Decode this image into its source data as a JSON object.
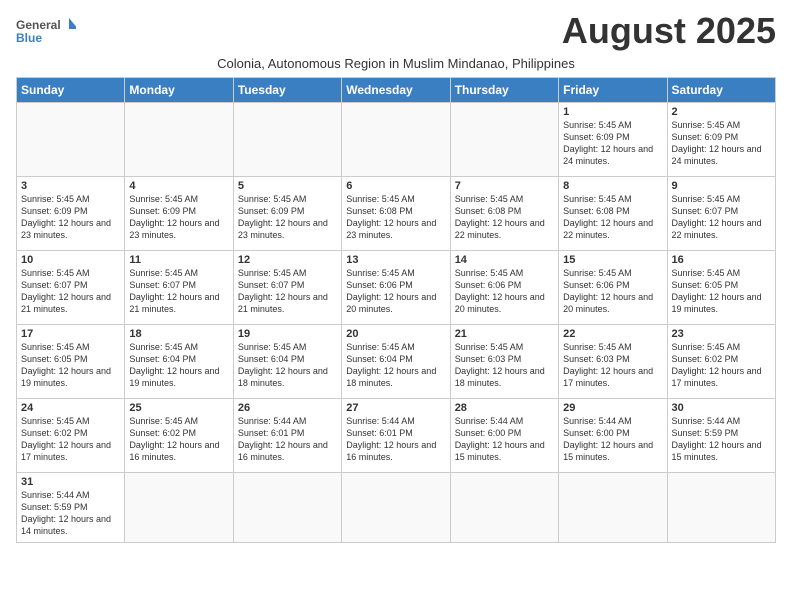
{
  "logo": {
    "text_general": "General",
    "text_blue": "Blue"
  },
  "title": "August 2025",
  "subtitle": "Colonia, Autonomous Region in Muslim Mindanao, Philippines",
  "days_of_week": [
    "Sunday",
    "Monday",
    "Tuesday",
    "Wednesday",
    "Thursday",
    "Friday",
    "Saturday"
  ],
  "weeks": [
    [
      {
        "day": "",
        "info": ""
      },
      {
        "day": "",
        "info": ""
      },
      {
        "day": "",
        "info": ""
      },
      {
        "day": "",
        "info": ""
      },
      {
        "day": "",
        "info": ""
      },
      {
        "day": "1",
        "info": "Sunrise: 5:45 AM\nSunset: 6:09 PM\nDaylight: 12 hours and 24 minutes."
      },
      {
        "day": "2",
        "info": "Sunrise: 5:45 AM\nSunset: 6:09 PM\nDaylight: 12 hours and 24 minutes."
      }
    ],
    [
      {
        "day": "3",
        "info": "Sunrise: 5:45 AM\nSunset: 6:09 PM\nDaylight: 12 hours and 23 minutes."
      },
      {
        "day": "4",
        "info": "Sunrise: 5:45 AM\nSunset: 6:09 PM\nDaylight: 12 hours and 23 minutes."
      },
      {
        "day": "5",
        "info": "Sunrise: 5:45 AM\nSunset: 6:09 PM\nDaylight: 12 hours and 23 minutes."
      },
      {
        "day": "6",
        "info": "Sunrise: 5:45 AM\nSunset: 6:08 PM\nDaylight: 12 hours and 23 minutes."
      },
      {
        "day": "7",
        "info": "Sunrise: 5:45 AM\nSunset: 6:08 PM\nDaylight: 12 hours and 22 minutes."
      },
      {
        "day": "8",
        "info": "Sunrise: 5:45 AM\nSunset: 6:08 PM\nDaylight: 12 hours and 22 minutes."
      },
      {
        "day": "9",
        "info": "Sunrise: 5:45 AM\nSunset: 6:07 PM\nDaylight: 12 hours and 22 minutes."
      }
    ],
    [
      {
        "day": "10",
        "info": "Sunrise: 5:45 AM\nSunset: 6:07 PM\nDaylight: 12 hours and 21 minutes."
      },
      {
        "day": "11",
        "info": "Sunrise: 5:45 AM\nSunset: 6:07 PM\nDaylight: 12 hours and 21 minutes."
      },
      {
        "day": "12",
        "info": "Sunrise: 5:45 AM\nSunset: 6:07 PM\nDaylight: 12 hours and 21 minutes."
      },
      {
        "day": "13",
        "info": "Sunrise: 5:45 AM\nSunset: 6:06 PM\nDaylight: 12 hours and 20 minutes."
      },
      {
        "day": "14",
        "info": "Sunrise: 5:45 AM\nSunset: 6:06 PM\nDaylight: 12 hours and 20 minutes."
      },
      {
        "day": "15",
        "info": "Sunrise: 5:45 AM\nSunset: 6:06 PM\nDaylight: 12 hours and 20 minutes."
      },
      {
        "day": "16",
        "info": "Sunrise: 5:45 AM\nSunset: 6:05 PM\nDaylight: 12 hours and 19 minutes."
      }
    ],
    [
      {
        "day": "17",
        "info": "Sunrise: 5:45 AM\nSunset: 6:05 PM\nDaylight: 12 hours and 19 minutes."
      },
      {
        "day": "18",
        "info": "Sunrise: 5:45 AM\nSunset: 6:04 PM\nDaylight: 12 hours and 19 minutes."
      },
      {
        "day": "19",
        "info": "Sunrise: 5:45 AM\nSunset: 6:04 PM\nDaylight: 12 hours and 18 minutes."
      },
      {
        "day": "20",
        "info": "Sunrise: 5:45 AM\nSunset: 6:04 PM\nDaylight: 12 hours and 18 minutes."
      },
      {
        "day": "21",
        "info": "Sunrise: 5:45 AM\nSunset: 6:03 PM\nDaylight: 12 hours and 18 minutes."
      },
      {
        "day": "22",
        "info": "Sunrise: 5:45 AM\nSunset: 6:03 PM\nDaylight: 12 hours and 17 minutes."
      },
      {
        "day": "23",
        "info": "Sunrise: 5:45 AM\nSunset: 6:02 PM\nDaylight: 12 hours and 17 minutes."
      }
    ],
    [
      {
        "day": "24",
        "info": "Sunrise: 5:45 AM\nSunset: 6:02 PM\nDaylight: 12 hours and 17 minutes."
      },
      {
        "day": "25",
        "info": "Sunrise: 5:45 AM\nSunset: 6:02 PM\nDaylight: 12 hours and 16 minutes."
      },
      {
        "day": "26",
        "info": "Sunrise: 5:44 AM\nSunset: 6:01 PM\nDaylight: 12 hours and 16 minutes."
      },
      {
        "day": "27",
        "info": "Sunrise: 5:44 AM\nSunset: 6:01 PM\nDaylight: 12 hours and 16 minutes."
      },
      {
        "day": "28",
        "info": "Sunrise: 5:44 AM\nSunset: 6:00 PM\nDaylight: 12 hours and 15 minutes."
      },
      {
        "day": "29",
        "info": "Sunrise: 5:44 AM\nSunset: 6:00 PM\nDaylight: 12 hours and 15 minutes."
      },
      {
        "day": "30",
        "info": "Sunrise: 5:44 AM\nSunset: 5:59 PM\nDaylight: 12 hours and 15 minutes."
      }
    ],
    [
      {
        "day": "31",
        "info": "Sunrise: 5:44 AM\nSunset: 5:59 PM\nDaylight: 12 hours and 14 minutes."
      },
      {
        "day": "",
        "info": ""
      },
      {
        "day": "",
        "info": ""
      },
      {
        "day": "",
        "info": ""
      },
      {
        "day": "",
        "info": ""
      },
      {
        "day": "",
        "info": ""
      },
      {
        "day": "",
        "info": ""
      }
    ]
  ]
}
